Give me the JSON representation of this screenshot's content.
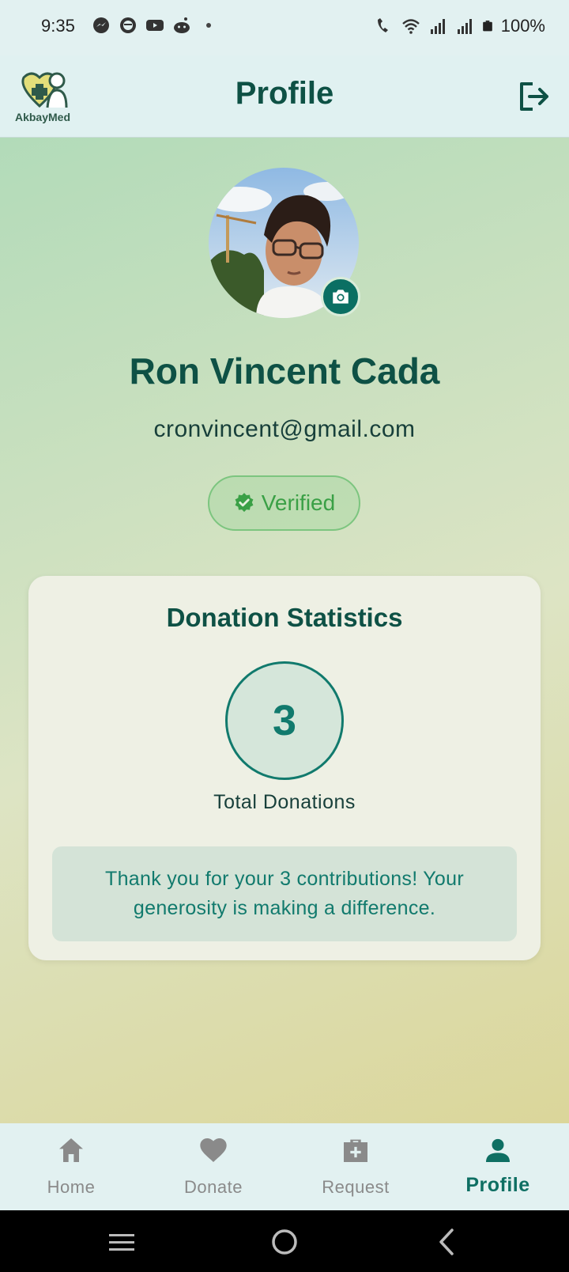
{
  "status_bar": {
    "time": "9:35",
    "battery": "100%"
  },
  "app_bar": {
    "title": "Profile",
    "logo_text": "AkbayMed"
  },
  "profile": {
    "name": "Ron Vincent Cada",
    "email": "cronvincent@gmail.com",
    "verified_label": "Verified"
  },
  "stats": {
    "title": "Donation Statistics",
    "total_donations": "3",
    "total_label": "Total Donations",
    "thanks_message": "Thank you for your 3 contributions! Your generosity is making a difference."
  },
  "bottom_nav": {
    "items": [
      {
        "label": "Home",
        "icon": "home-icon"
      },
      {
        "label": "Donate",
        "icon": "heart-icon"
      },
      {
        "label": "Request",
        "icon": "medical-kit-icon"
      },
      {
        "label": "Profile",
        "icon": "person-icon"
      }
    ],
    "active_index": 3
  },
  "colors": {
    "primary": "#0e5145",
    "accent": "#117a6d",
    "verified": "#3aa046",
    "inactive_nav": "#8a8a8a"
  }
}
